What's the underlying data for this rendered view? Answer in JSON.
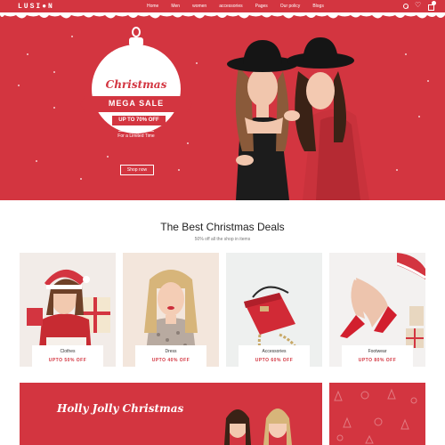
{
  "brand": {
    "logo": "LUSI●N"
  },
  "nav": {
    "items": [
      "Home",
      "Men",
      "women",
      "accessories",
      "Pages",
      "Our policy",
      "Blogs"
    ]
  },
  "header_icons": [
    "search-icon",
    "heart-icon",
    "shopping-bag-icon"
  ],
  "hero": {
    "ornament_title": "Christmas",
    "ribbon": "MEGA SALE",
    "discount": "UP TO 70% OFF",
    "subtitle": "For a Limited Time",
    "button": "Shop now"
  },
  "deals": {
    "title": "The Best Christmas Deals",
    "subtitle": "50% off all the shop in items",
    "cards": [
      {
        "name": "Clothes",
        "deal": "UPTO 50% OFF"
      },
      {
        "name": "Dress",
        "deal": "UPTO 40% OFF"
      },
      {
        "name": "Accessories",
        "deal": "UPTO 60% OFF"
      },
      {
        "name": "Footwear",
        "deal": "UPTO 80% OFF"
      }
    ]
  },
  "banner": {
    "title": "Holly Jolly Christmas"
  },
  "colors": {
    "accent": "#d33540",
    "white": "#ffffff"
  }
}
